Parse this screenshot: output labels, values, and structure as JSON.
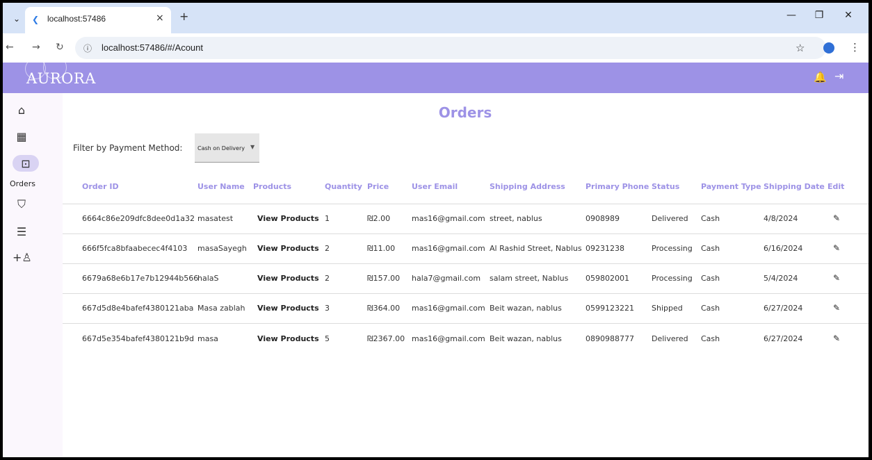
{
  "browser": {
    "tab_title": "localhost:57486",
    "tab_close": "×",
    "new_tab": "+",
    "url": "localhost:57486/#/Acount",
    "menu_glyph": "⌄",
    "favicon_glyph": "❮",
    "back_glyph": "←",
    "forward_glyph": "→",
    "reload_glyph": "↻",
    "info_glyph": "ⓘ",
    "star_glyph": "☆",
    "avatar_glyph": "●",
    "kebab_glyph": "⋮",
    "minimize_glyph": "—",
    "restore_glyph": "❐",
    "close_glyph": "✕"
  },
  "app": {
    "logo": "AURORA",
    "bell_glyph": "🔔",
    "logout_glyph": "⇥"
  },
  "sidebar": {
    "items": [
      {
        "icon": "home-icon",
        "glyph": "⌂"
      },
      {
        "icon": "dashboard-icon",
        "glyph": "▦"
      },
      {
        "icon": "orders-icon",
        "glyph": "⊡",
        "label": "Orders"
      },
      {
        "icon": "bag-icon",
        "glyph": "⛉"
      },
      {
        "icon": "message-icon",
        "glyph": "☰"
      },
      {
        "icon": "add-user-icon",
        "glyph": "+♙"
      }
    ]
  },
  "page": {
    "title": "Orders",
    "filter_label": "Filter by Payment Method:",
    "filter_value": "Cash on Delivery",
    "filter_caret": "▼"
  },
  "table": {
    "headers": [
      "Order ID",
      "User Name",
      "Products",
      "Quantity",
      "Price",
      "User Email",
      "Shipping Address",
      "Primary Phone",
      "Status",
      "Payment Type",
      "Shipping Date",
      "Edit"
    ],
    "edit_glyph": "✎",
    "rows": [
      [
        "6664c86e209dfc8dee0d1a32",
        "masatest",
        "View Products",
        "1",
        "₪2.00",
        "mas16@gmail.com",
        "street, nablus",
        "0908989",
        "Delivered",
        "Cash",
        "4/8/2024"
      ],
      [
        "666f5fca8bfaabecec4f4103",
        "masaSayegh",
        "View Products",
        "2",
        "₪11.00",
        "mas16@gmail.com",
        "Al Rashid Street, Nablus",
        "09231238",
        "Processing",
        "Cash",
        "6/16/2024"
      ],
      [
        "6679a68e6b17e7b12944b566",
        "halaS",
        "View Products",
        "2",
        "₪157.00",
        "hala7@gmail.com",
        "salam street, Nablus",
        "059802001",
        "Processing",
        "Cash",
        "5/4/2024"
      ],
      [
        "667d5d8e4bafef4380121aba",
        "Masa zablah",
        "View Products",
        "3",
        "₪364.00",
        "mas16@gmail.com",
        "Beit wazan, nablus",
        "0599123221",
        "Shipped",
        "Cash",
        "6/27/2024"
      ],
      [
        "667d5e354bafef4380121b9d",
        "masa",
        "View Products",
        "5",
        "₪2367.00",
        "mas16@gmail.com",
        "Beit wazan, nablus",
        "0890988777",
        "Delivered",
        "Cash",
        "6/27/2024"
      ]
    ]
  },
  "colors": {
    "accent": "#9d92e6",
    "sidebar_bg": "#fbf7fd",
    "active_pill": "#d9d3f3"
  }
}
